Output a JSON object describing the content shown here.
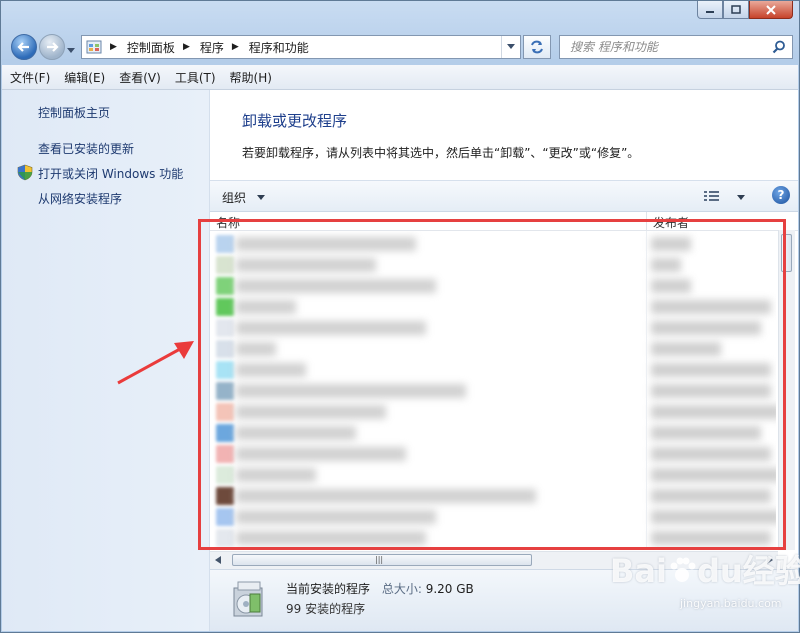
{
  "window": {
    "caption_buttons": {
      "minimize": "minimize-icon",
      "maximize": "maximize-icon",
      "close": "close-icon"
    }
  },
  "nav": {
    "breadcrumbs": [
      "控制面板",
      "程序",
      "程序和功能"
    ],
    "search_placeholder": "搜索 程序和功能"
  },
  "menu": [
    "文件(F)",
    "编辑(E)",
    "查看(V)",
    "工具(T)",
    "帮助(H)"
  ],
  "sidebar": {
    "items": [
      {
        "label": "控制面板主页"
      },
      {
        "label": "查看已安装的更新"
      },
      {
        "label": "打开或关闭 Windows 功能",
        "icon": "shield-icon"
      },
      {
        "label": "从网络安装程序"
      }
    ]
  },
  "main": {
    "title": "卸载或更改程序",
    "description": "若要卸载程序，请从列表中将其选中，然后单击“卸载”、“更改”或“修复”。",
    "toolbar": {
      "organize": "组织"
    },
    "columns": {
      "name": "名称",
      "publisher": "发布者"
    },
    "rows_note_blurred": true,
    "icon_colors": [
      "#b9d3ef",
      "#d8e4d0",
      "#7fd27a",
      "#61c85c",
      "#e3e7ee",
      "#d8e0ea",
      "#a8e3f5",
      "#95b3c9",
      "#f4c4b8",
      "#6ca7de",
      "#f2b3b3",
      "#dcebdc",
      "#6e4a3c",
      "#a6c6f0",
      "#e4e8ee"
    ]
  },
  "details": {
    "title": "当前安装的程序",
    "size_label": "总大小:",
    "size_value": "9.20 GB",
    "count_text": "99 安装的程序"
  },
  "watermark": {
    "brand": "Bai",
    "brand2": "du",
    "suffix": "经验",
    "url": "jingyan.baidu.com"
  },
  "annotation": {
    "highlight_color": "#e64040"
  }
}
